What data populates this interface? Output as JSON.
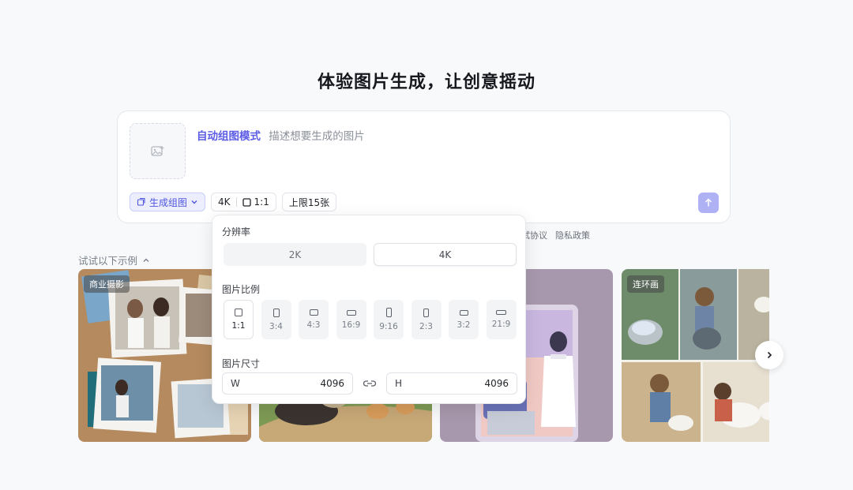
{
  "heading": "体验图片生成，让创意摇动",
  "prompt": {
    "mode_label": "自动组图模式",
    "placeholder": "描述想要生成的图片"
  },
  "toolbar": {
    "group_button": "生成组图",
    "resolution": "4K",
    "ratio": "1:1",
    "limit": "上限15张"
  },
  "links": [
    "试协议",
    "隐私政策"
  ],
  "examples": {
    "label": "试试以下示例",
    "cards": [
      {
        "tag": "商业摄影"
      },
      {
        "tag": ""
      },
      {
        "tag": ""
      },
      {
        "tag": "连环画"
      }
    ]
  },
  "popover": {
    "resolution_label": "分辨率",
    "resolutions": [
      "2K",
      "4K"
    ],
    "selected_resolution": "4K",
    "ratio_label": "图片比例",
    "ratios": [
      "1:1",
      "3:4",
      "4:3",
      "16:9",
      "9:16",
      "2:3",
      "3:2",
      "21:9"
    ],
    "selected_ratio": "1:1",
    "size_label": "图片尺寸",
    "width_label": "W",
    "width_value": "4096",
    "height_label": "H",
    "height_value": "4096"
  },
  "colors": {
    "accent": "#5b5be6",
    "send_button": "#aeb2f5"
  }
}
